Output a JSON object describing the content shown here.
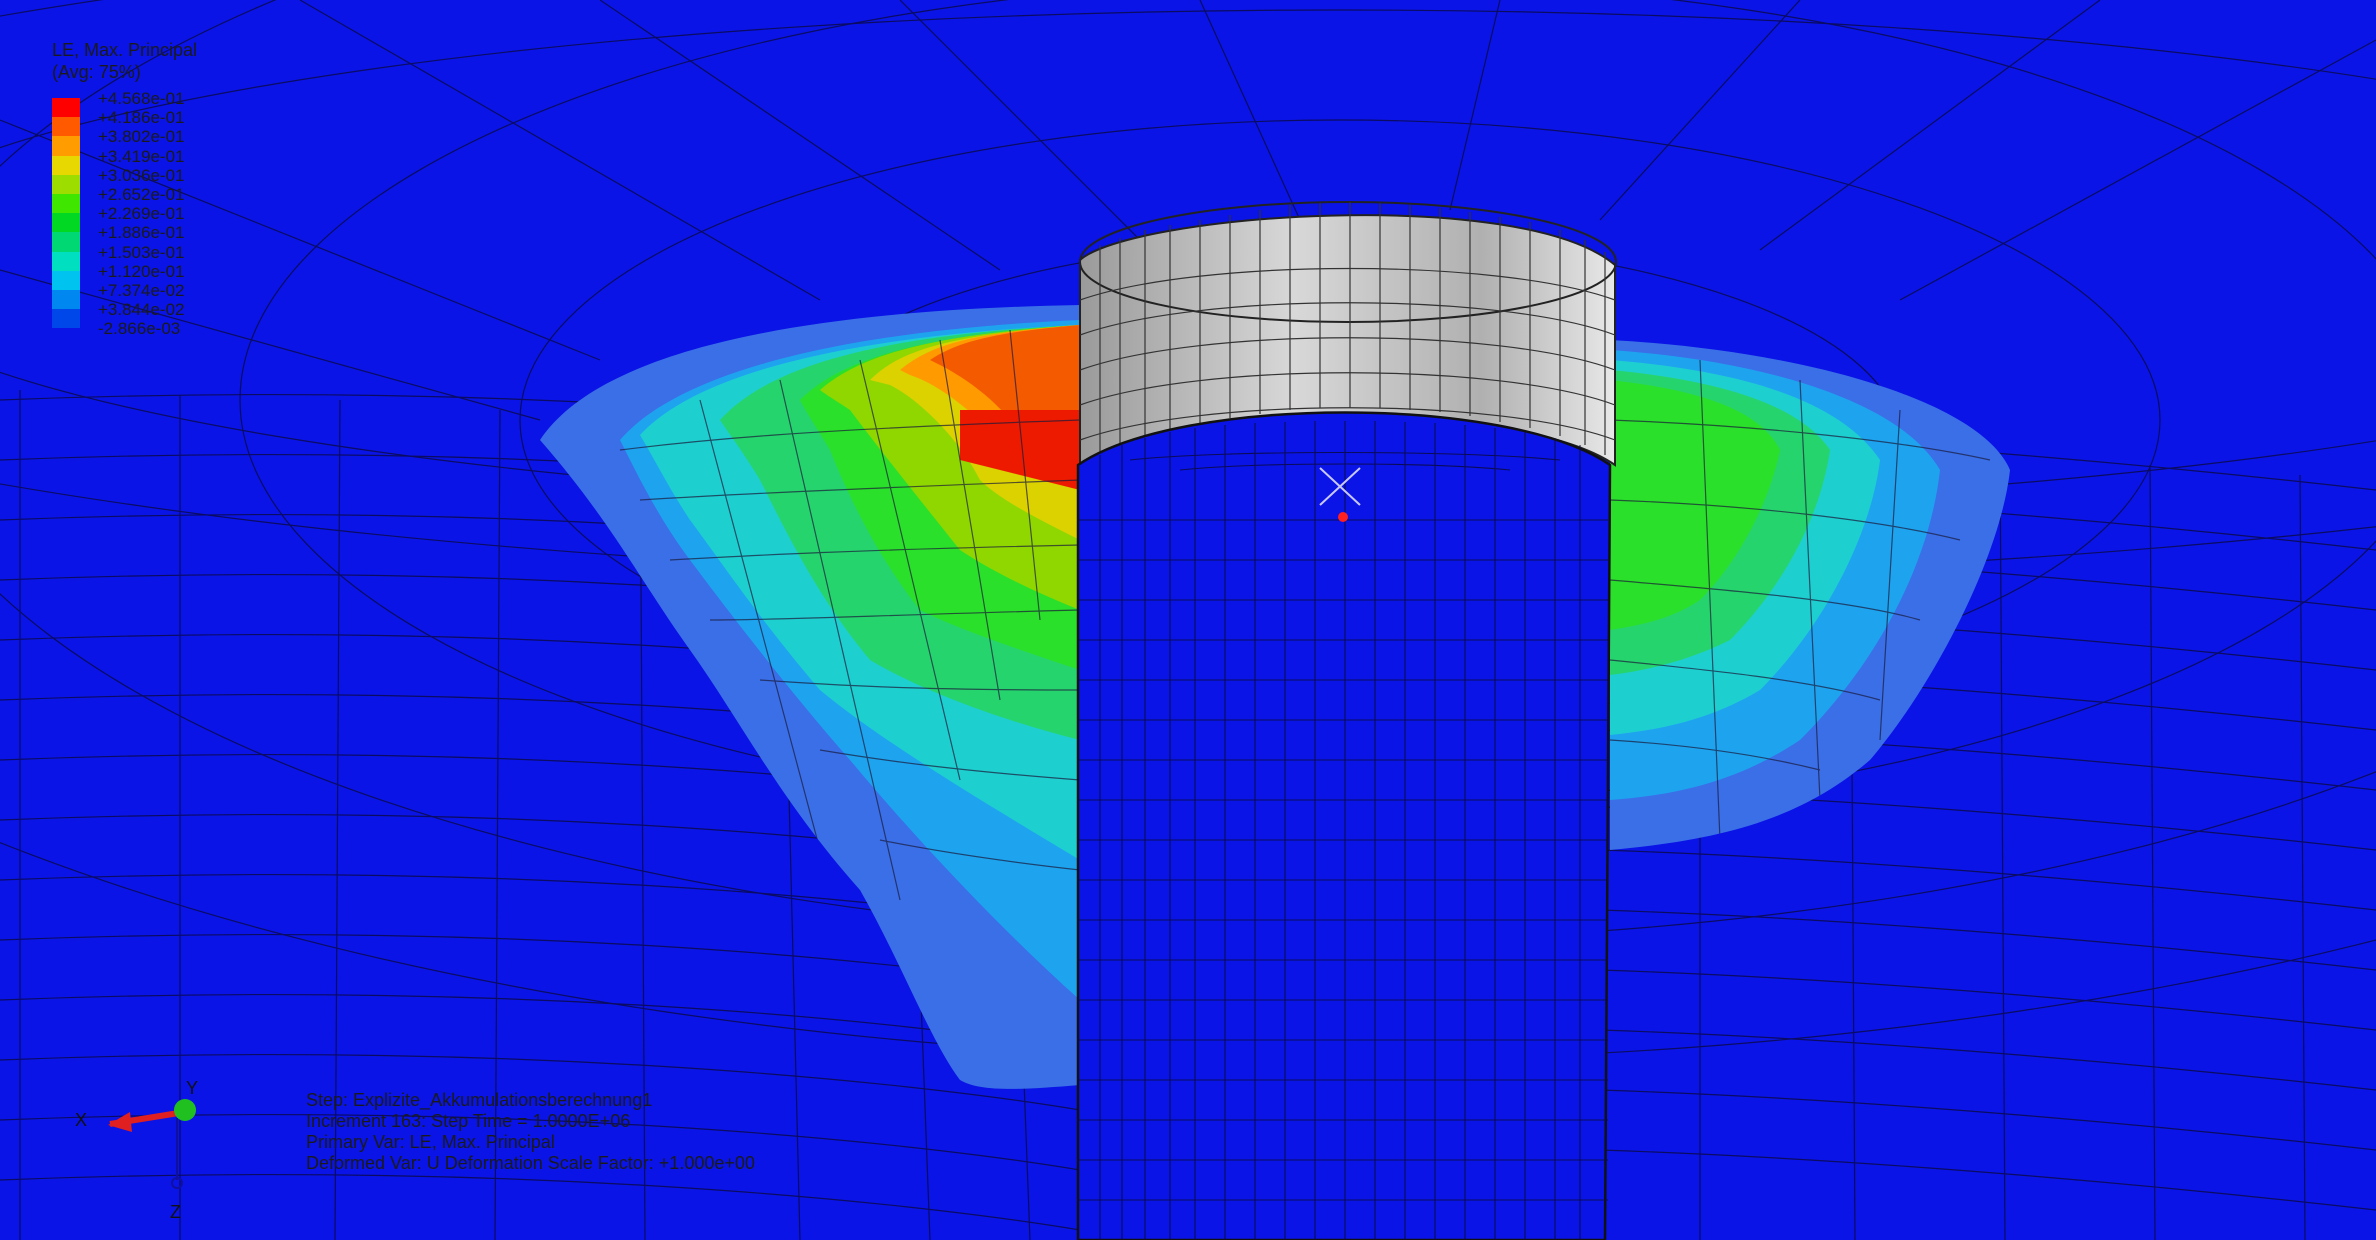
{
  "legend": {
    "title_line1": "LE, Max. Principal",
    "title_line2": "(Avg: 75%)",
    "entries": [
      {
        "value": "+4.568e-01",
        "color": "#ff0000"
      },
      {
        "value": "+4.186e-01",
        "color": "#ff5a00"
      },
      {
        "value": "+3.802e-01",
        "color": "#ff9c00"
      },
      {
        "value": "+3.419e-01",
        "color": "#e6d800"
      },
      {
        "value": "+3.036e-01",
        "color": "#9ddd00"
      },
      {
        "value": "+2.652e-01",
        "color": "#3fe600"
      },
      {
        "value": "+2.269e-01",
        "color": "#00d824"
      },
      {
        "value": "+1.886e-01",
        "color": "#00d973"
      },
      {
        "value": "+1.503e-01",
        "color": "#00dfc0"
      },
      {
        "value": "+1.120e-01",
        "color": "#00c3f0"
      },
      {
        "value": "+7.374e-02",
        "color": "#0087f0"
      },
      {
        "value": "+3.844e-02",
        "color": "#0047ea"
      },
      {
        "value": "-2.866e-03",
        "color": "#0a14e6"
      }
    ]
  },
  "info": {
    "step": "Step: Explizite_Akkumulationsberechnung1",
    "increment": "Increment    163: Step Time =    1.0000E+06",
    "primary_var": "Primary Var: LE, Max. Principal",
    "deformed_var": "Deformed Var: U   Deformation Scale Factor: +1.000e+00"
  },
  "triad": {
    "x_label": "X",
    "y_label": "Y",
    "z_label": "Z"
  }
}
